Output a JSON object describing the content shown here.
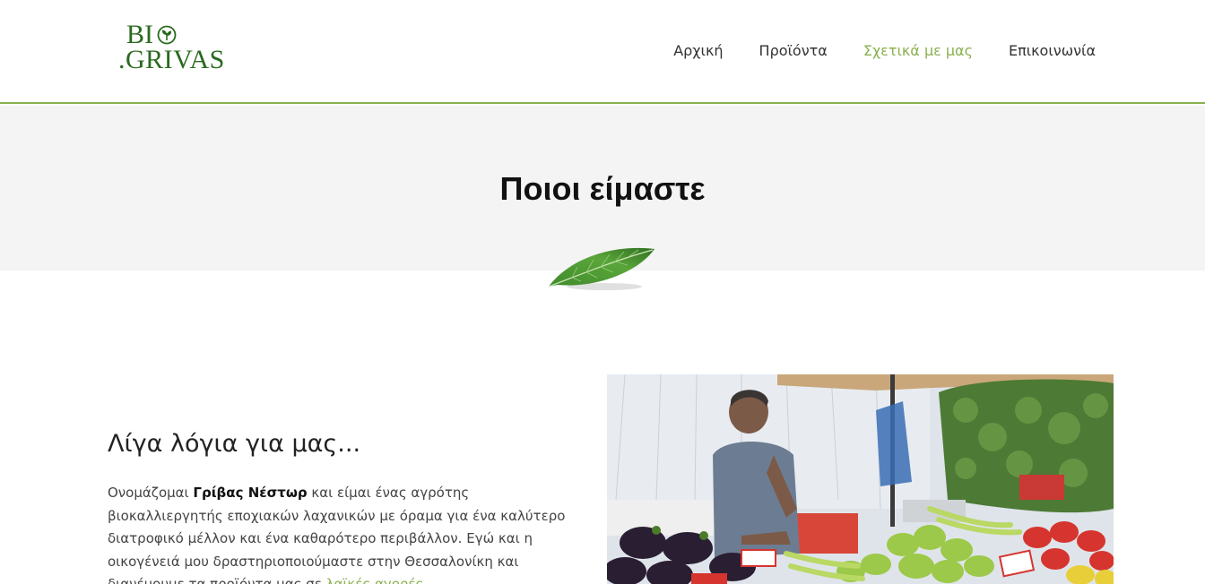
{
  "brand": {
    "logo_line1": "BI",
    "logo_line2": ".GRIVAS",
    "logo_color": "#2a6a1f"
  },
  "nav": {
    "items": [
      {
        "label": "Αρχική",
        "active": false
      },
      {
        "label": "Προϊόντα",
        "active": false
      },
      {
        "label": "Σχετικά με μας",
        "active": true
      },
      {
        "label": "Επικοινωνία",
        "active": false
      }
    ],
    "active_color": "#8ab04f"
  },
  "hero": {
    "title": "Ποιοι είμαστε",
    "icon": "leaf-icon"
  },
  "about": {
    "heading": "Λίγα λόγια για μας...",
    "text_before": "Ονομάζομαι ",
    "name_bold": "Γρίβας Νέστωρ",
    "text_after": " και είμαι ένας αγρότης βιοκαλλιεργητής εποχιακών λαχανικών με όραμα για ένα καλύτερο διατροφικό μέλλον και ένα καθαρότερο περιβάλλον. Εγώ και η οικογένειά μου δραστηριοποιούμαστε στην Θεσσαλονίκη και διανέμουμε τα προϊόντα μας σε ",
    "link_text": "λαϊκές αγορές",
    "text_end": "."
  },
  "photo": {
    "icon": "market-photo"
  }
}
